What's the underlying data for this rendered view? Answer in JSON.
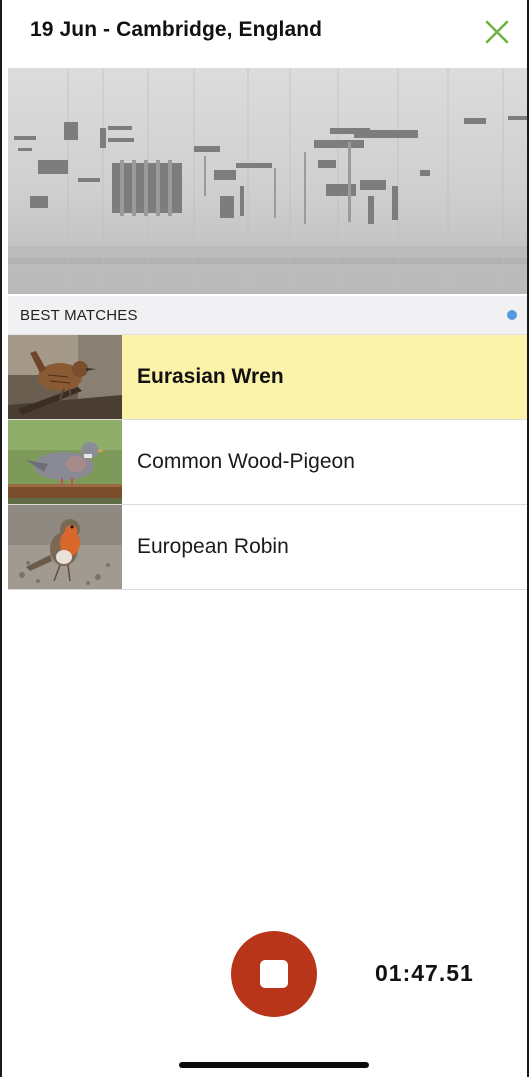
{
  "header": {
    "title": "19 Jun - Cambridge, England",
    "close_icon": "close-x-icon",
    "close_color": "#6db33f"
  },
  "spectrogram": {
    "label": "spectrogram"
  },
  "section": {
    "label": "BEST MATCHES",
    "dot_color": "#5a98e0"
  },
  "matches": [
    {
      "name": "Eurasian Wren",
      "highlighted": true,
      "thumb": "eurasian-wren-photo"
    },
    {
      "name": "Common Wood-Pigeon",
      "highlighted": false,
      "thumb": "common-wood-pigeon-photo"
    },
    {
      "name": "European Robin",
      "highlighted": false,
      "thumb": "european-robin-photo"
    }
  ],
  "recorder": {
    "button_color": "#b83519",
    "icon": "stop-icon",
    "elapsed": "01:47.51"
  },
  "colors": {
    "highlight": "#fbf3a9",
    "section_bg": "#f1f1f3"
  }
}
